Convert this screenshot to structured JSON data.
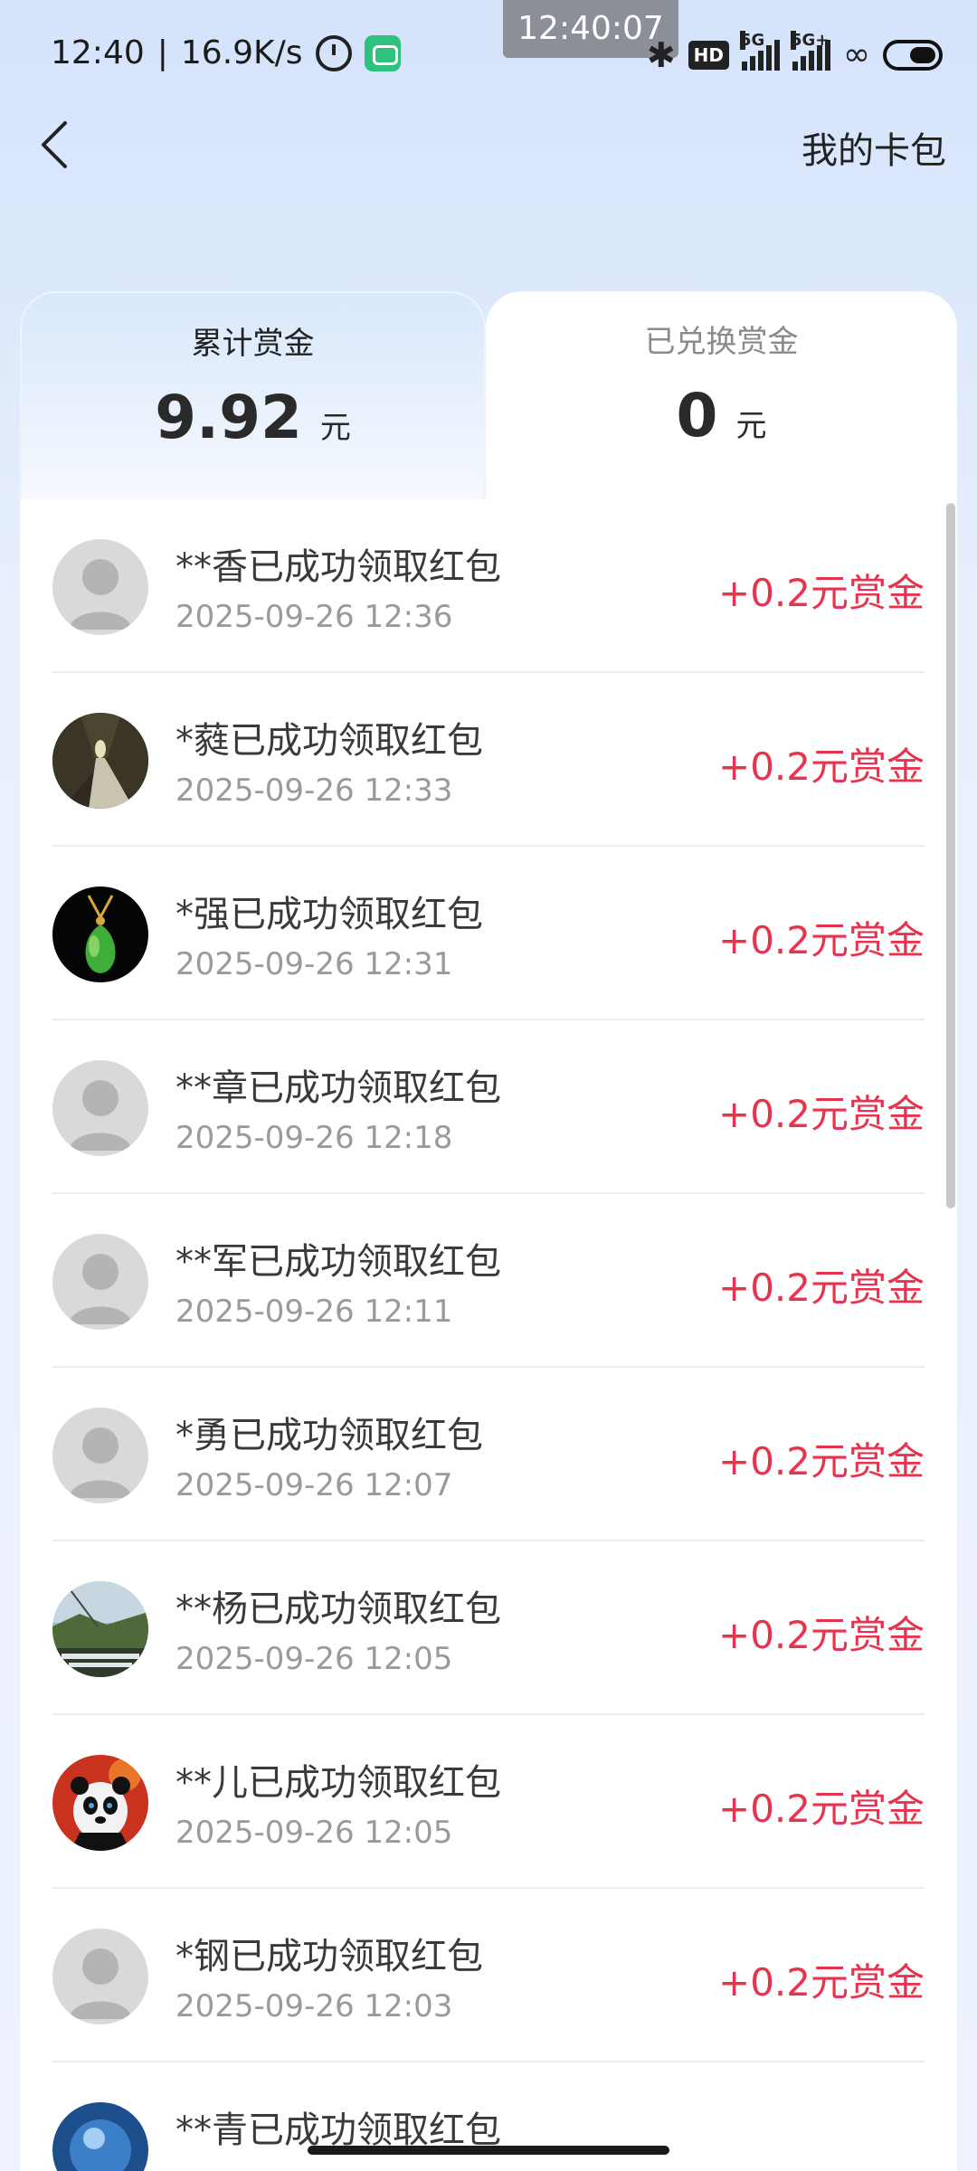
{
  "status_bar": {
    "time": "12:40",
    "separator": "|",
    "speed": "16.9K/s",
    "overlay_time": "12:40:07",
    "hd_label": "HD",
    "network_1": "5G",
    "network_2": "5G+"
  },
  "header": {
    "back_icon": "chevron-left-icon",
    "right_link": "我的卡包"
  },
  "tabs": [
    {
      "title": "累计赏金",
      "amount": "9.92",
      "unit": "元",
      "active": true
    },
    {
      "title": "已兑换赏金",
      "amount": "0",
      "unit": "元",
      "active": false
    }
  ],
  "records": [
    {
      "title": "**香已成功领取红包",
      "time": "2025-09-26 12:36",
      "reward": "+0.2元赏金",
      "avatar": "default-avatar"
    },
    {
      "title": "*蕤已成功领取红包",
      "time": "2025-09-26 12:33",
      "reward": "+0.2元赏金",
      "avatar": "forest-road-photo"
    },
    {
      "title": "*强已成功领取红包",
      "time": "2025-09-26 12:31",
      "reward": "+0.2元赏金",
      "avatar": "jade-pendant-photo"
    },
    {
      "title": "**章已成功领取红包",
      "time": "2025-09-26 12:18",
      "reward": "+0.2元赏金",
      "avatar": "default-avatar"
    },
    {
      "title": "**军已成功领取红包",
      "time": "2025-09-26 12:11",
      "reward": "+0.2元赏金",
      "avatar": "default-avatar"
    },
    {
      "title": "*勇已成功领取红包",
      "time": "2025-09-26 12:07",
      "reward": "+0.2元赏金",
      "avatar": "default-avatar"
    },
    {
      "title": "**杨已成功领取红包",
      "time": "2025-09-26 12:05",
      "reward": "+0.2元赏金",
      "avatar": "landscape-photo"
    },
    {
      "title": "**儿已成功领取红包",
      "time": "2025-09-26 12:05",
      "reward": "+0.2元赏金",
      "avatar": "panda-photo"
    },
    {
      "title": "*钢已成功领取红包",
      "time": "2025-09-26 12:03",
      "reward": "+0.2元赏金",
      "avatar": "default-avatar"
    },
    {
      "title": "**青已成功领取红包",
      "time": "",
      "reward": "",
      "avatar": "blue-photo"
    }
  ],
  "colors": {
    "reward": "#e8334f",
    "background": "#dce8fb"
  }
}
